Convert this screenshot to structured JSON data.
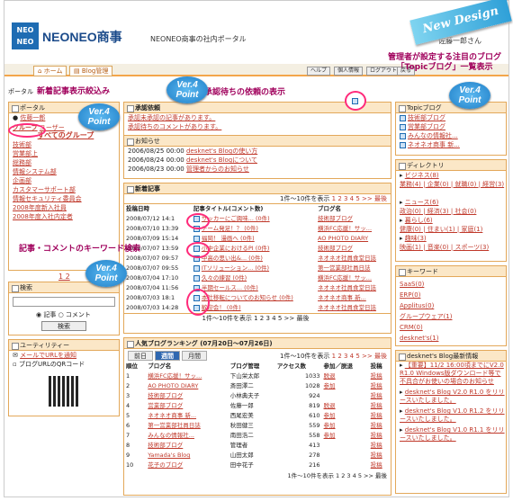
{
  "header": {
    "logo_line1": "NEO",
    "logo_line2": "NEO",
    "app_name": "NEONEO商事",
    "portal_title": "NEONEO商事の社内ポータル",
    "user": "佐藤一郎さん",
    "ribbon": "New Design"
  },
  "nav": {
    "home": "ホーム",
    "blog": "Blog管理",
    "help": "ヘルプ",
    "personal": "個人情報",
    "logout": "ログアウト",
    "back": "戻る"
  },
  "breadcrumb": "ポータル",
  "annotations": {
    "newest": "新着記事表示絞込み",
    "approval": "承認待ちの依頼の表示",
    "topic": "管理者が設定する注目のブログ\n「Topicブログ」一覧表示",
    "keyword": "記事・コメントのキーワード検索",
    "v4": "Ver.4\nPoint"
  },
  "portal_box": {
    "title": "ポータル",
    "user_link": "佐藤一郎",
    "tab_group": "グループ",
    "tab_user": "ユーザー",
    "all_groups": "すべてのグループ",
    "groups": [
      "技術部",
      "営業部上",
      "総務部",
      "情報システム部",
      "企画部",
      "カスタマーサポート部",
      "情報セキュリティ委員会",
      "2008年度新入社員",
      "2008年度入社内定者"
    ],
    "pager": "1 2"
  },
  "search_box": {
    "title": "検索",
    "opt_article": "記事",
    "opt_comment": "コメント",
    "button": "検索"
  },
  "utility": {
    "title": "ユーティリティー",
    "items": [
      "メールでURLを通知",
      "ブログURLのQRコード"
    ]
  },
  "approval": {
    "title": "承認依頼",
    "items": [
      "承認未承認の記事があります。",
      "承認待ちのコメントがあります。"
    ]
  },
  "notice": {
    "title": "お知らせ",
    "rows": [
      {
        "date": "2006/08/25 00:00",
        "text": "desknet's Blogの使い方"
      },
      {
        "date": "2006/08/24 00:00",
        "text": "desknet's Blogについて"
      },
      {
        "date": "2006/08/23 00:00",
        "text": "管理者からのお知らせ"
      }
    ]
  },
  "new_articles": {
    "title": "新着記事",
    "range": "1件～10件を表示",
    "pages": "1 2 3 4 5 >> 最後",
    "col_date": "投稿日時",
    "col_title": "記事タイトル(コメント数)",
    "col_blog": "ブログ名",
    "rows": [
      {
        "date": "2008/07/12 14:1",
        "title": "サッカーにご興味... (0件)",
        "blog": "技術部ブログ"
      },
      {
        "date": "2008/07/10 13:39",
        "title": "チーム発足！？ (0件)",
        "blog": "横浜FC応援！サッ..."
      },
      {
        "date": "2008/07/09 15:14",
        "title": "福岡！ 漫画へ (0件)",
        "blog": "AO PHOTO DIARY"
      },
      {
        "date": "2008/07/07 13:59",
        "title": "小中企業におけるPI (0件)",
        "blog": "技術部ブログ"
      },
      {
        "date": "2008/07/07 09:57",
        "title": "中高の思い出&... (0件)",
        "blog": "ネオネオ社員食堂日誌"
      },
      {
        "date": "2008/07/07 09:55",
        "title": "ITソリューション... (0件)",
        "blog": "第一営業部社員日誌"
      },
      {
        "date": "2008/07/04 17:10",
        "title": "久々の練習 (0件)",
        "blog": "横浜FC応援！サッ..."
      },
      {
        "date": "2008/07/04 11:56",
        "title": "半期セールス... (0件)",
        "blog": "ネオネオ社員食堂日誌"
      },
      {
        "date": "2008/07/03 18:1",
        "title": "本社移転についてのお知らせ (0件)",
        "blog": "ネオネオ商事 新..."
      },
      {
        "date": "2008/07/03 14:28",
        "title": "歓迎会！ (0件)",
        "blog": "ネオネオ社員食堂日誌"
      }
    ],
    "footer": "1件～10件を表示 1 2 3 4 5 >> 最後"
  },
  "ranking": {
    "title": "人気ブログランキング (07月20日～07月26日)",
    "tab_prev": "前日",
    "tab_week": "週間",
    "tab_month": "月間",
    "range": "1件～10件を表示",
    "pages": "1 2 3 4 5 >> 最後",
    "col_rank": "順位",
    "col_blog": "ブログ名",
    "col_admin": "ブログ管理",
    "col_access": "アクセス数",
    "col_join": "参加／脱退",
    "col_post": "投稿",
    "rows": [
      {
        "rank": "1",
        "blog": "横浜FC応援！サッ...",
        "admin": "下山栄太郎",
        "access": "1033",
        "join": "脱退",
        "post": "投稿"
      },
      {
        "rank": "2",
        "blog": "AO PHOTO DIARY",
        "admin": "斎田澤二",
        "access": "1028",
        "join": "参加",
        "post": "投稿"
      },
      {
        "rank": "3",
        "blog": "技術部ブログ",
        "admin": "小林典夫子",
        "access": "924",
        "join": "",
        "post": "投稿"
      },
      {
        "rank": "4",
        "blog": "営業部ブログ",
        "admin": "佐藤一郎",
        "access": "819",
        "join": "脱退",
        "post": "投稿"
      },
      {
        "rank": "5",
        "blog": "ネオネオ商事 新...",
        "admin": "西尾宏美",
        "access": "610",
        "join": "参加",
        "post": "投稿"
      },
      {
        "rank": "6",
        "blog": "第一営業部社員日誌",
        "admin": "秋田健三",
        "access": "559",
        "join": "参加",
        "post": "投稿"
      },
      {
        "rank": "7",
        "blog": "みんなの情報社...",
        "admin": "南田浩二",
        "access": "558",
        "join": "参加",
        "post": "投稿"
      },
      {
        "rank": "8",
        "blog": "技術部ブログ",
        "admin": "管理者",
        "access": "413",
        "join": "",
        "post": "投稿"
      },
      {
        "rank": "9",
        "blog": "Yamada's Blog",
        "admin": "山田太郎",
        "access": "278",
        "join": "",
        "post": "投稿"
      },
      {
        "rank": "10",
        "blog": "花子のブログ",
        "admin": "田中花子",
        "access": "216",
        "join": "",
        "post": "投稿"
      }
    ],
    "footer": "1件～10件を表示 1 2 3 4 5 >> 最後"
  },
  "topic": {
    "title": "Topicブログ",
    "items": [
      "技術部ブログ",
      "営業部ブログ",
      "みんなの情報社...",
      "ネオネオ商事 新..."
    ]
  },
  "directory": {
    "title": "ディレクトリ",
    "cat1": "ビジネス(8)",
    "cat1_items": "業務(4) | 企業(0) | 就職(0) | 経営(3)",
    "cat2": "ニュース(6)",
    "cat2_items": "政治(0) | 経済(3) | 社会(0)",
    "cat3": "暮らし(6)",
    "cat3_items": "健康(0) | 住まい(1) | 家庭(1)",
    "cat4": "趣味(3)",
    "cat4_items": "映画(1) | 音楽(0) | スポーツ(3)"
  },
  "keyword": {
    "title": "キーワード",
    "items": [
      "SaaS(0)",
      "ERP(0)",
      "Applitus(0)",
      "グループウェア(1)",
      "CRM(0)",
      "desknet's(1)"
    ]
  },
  "latest": {
    "title": "desknet's Blog最新情報",
    "items": [
      "【重要】11/2 16:00頃までにV2.0 R1.0 Windows版ダウンロード等で不具合がお使いの場合のお知らせ",
      "desknet's Blog V2.0 R1.0 をリリースいたしました。",
      "desknet's Blog V1.0 R1.2 をリリースいたしました。",
      "desknet's Blog V1.0 R1.1 をリリースいたしました。"
    ]
  }
}
